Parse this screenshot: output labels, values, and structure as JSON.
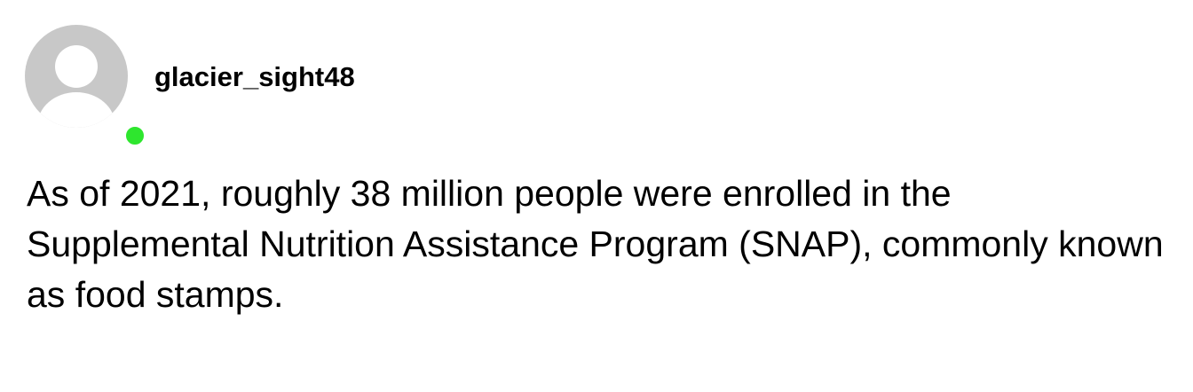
{
  "post": {
    "author": {
      "username": "glacier_sight48",
      "avatar_icon": "default-user-avatar-icon",
      "status": "online",
      "status_color": "#2ee62e"
    },
    "body": "As of 2021, roughly 38 million people were enrolled in the Supplemental Nutrition Assistance Program (SNAP), commonly known as food stamps."
  }
}
